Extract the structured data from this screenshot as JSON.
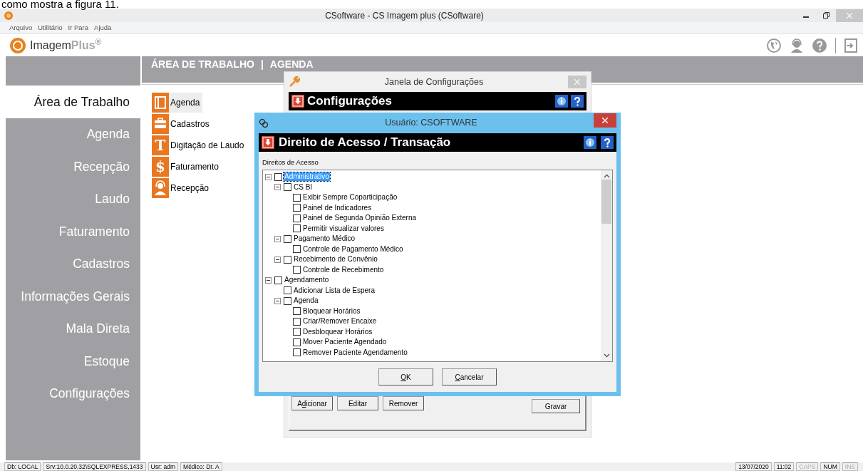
{
  "document_caption": "como mostra a figura 11.",
  "window": {
    "title": "CSoftware - CS Imagem plus (CSoftware)"
  },
  "menu": [
    "Arquivo",
    "Utilitário",
    "Ir Para",
    "Ajuda"
  ],
  "logo": {
    "name": "Imagem",
    "accent": "Plus$^{®}$"
  },
  "sidebar": {
    "items": [
      {
        "label": "Área de Trabalho",
        "selected": true
      },
      {
        "label": "Agenda",
        "selected": false
      },
      {
        "label": "Recepção",
        "selected": false
      },
      {
        "label": "Laudo",
        "selected": false
      },
      {
        "label": "Faturamento",
        "selected": false
      },
      {
        "label": "Cadastros",
        "selected": false
      },
      {
        "label": "Informações Gerais",
        "selected": false
      },
      {
        "label": "Mala Direta",
        "selected": false
      },
      {
        "label": "Estoque",
        "selected": false
      },
      {
        "label": "Configurações",
        "selected": false
      }
    ]
  },
  "breadcrumb": [
    "ÁREA DE TRABALHO",
    "|",
    "AGENDA"
  ],
  "tiles": [
    {
      "label": "Agenda",
      "kind": "book",
      "selected": true
    },
    {
      "label": "Cadastros",
      "kind": "case",
      "selected": false
    },
    {
      "label": "Digitação de Laudo",
      "kind": "glyph",
      "glyph": "T",
      "selected": false
    },
    {
      "label": "Faturamento",
      "kind": "glyph",
      "glyph": "$",
      "selected": false
    },
    {
      "label": "Recepção",
      "kind": "person",
      "selected": false
    }
  ],
  "config_window": {
    "title": "Janela de Configurações",
    "header": "Configurações",
    "buttons": [
      {
        "prefix": "A",
        "key": "d",
        "rest": "icionar"
      },
      {
        "rest": "Editar"
      },
      {
        "rest": "Remover"
      }
    ],
    "save_button": "Gravar"
  },
  "user_dialog": {
    "title": "Usuário: CSOFTWARE",
    "header": "Direito de Acesso / Transação",
    "tree_label": "Direitos de Acesso",
    "tree": [
      {
        "label": "Administrativo",
        "checked": false,
        "selected": true,
        "expanded": true,
        "children": [
          {
            "label": "CS BI",
            "checked": false,
            "selected": false,
            "expanded": true,
            "children": [
              {
                "label": "Exibir Sempre Coparticipação",
                "checked": false,
                "selected": false
              },
              {
                "label": "Painel de Indicadores",
                "checked": false,
                "selected": false
              },
              {
                "label": "Painel de Segunda Opinião Externa",
                "checked": false,
                "selected": false
              },
              {
                "label": "Permitir visualizar valores",
                "checked": false,
                "selected": false
              }
            ]
          },
          {
            "label": "Pagamento Médico",
            "checked": false,
            "selected": false,
            "expanded": true,
            "children": [
              {
                "label": "Controle de Pagamento Médico",
                "checked": false,
                "selected": false
              }
            ]
          },
          {
            "label": "Recebimento de Convênio",
            "checked": false,
            "selected": false,
            "expanded": true,
            "children": [
              {
                "label": "Controle de Recebimento",
                "checked": false,
                "selected": false
              }
            ]
          }
        ]
      },
      {
        "label": "Agendamento",
        "checked": false,
        "selected": false,
        "expanded": true,
        "children": [
          {
            "label": "Adicionar Lista de Espera",
            "checked": false,
            "selected": false
          },
          {
            "label": "Agenda",
            "checked": false,
            "selected": false,
            "expanded": true,
            "children": [
              {
                "label": "Bloquear Horários",
                "checked": false,
                "selected": false
              },
              {
                "label": "Criar/Remover Encaixe",
                "checked": false,
                "selected": false
              },
              {
                "label": "Desbloquear Horários",
                "checked": false,
                "selected": false
              },
              {
                "label": "Mover Paciente Agendado",
                "checked": false,
                "selected": false
              },
              {
                "label": "Remover Paciente Agendamento",
                "checked": false,
                "selected": false
              }
            ]
          }
        ]
      }
    ],
    "buttons": [
      {
        "key": "O",
        "rest": "K"
      },
      {
        "key": "C",
        "rest": "ancelar"
      }
    ]
  },
  "status_bar": {
    "left": [
      "Db: LOCAL",
      "Srv:10.0.20.32\\SQLEXPRESS,1433",
      "Usr: adm",
      "Médico: Dr. A"
    ],
    "right": [
      {
        "text": "13/07/2020",
        "enabled": true
      },
      {
        "text": "11:02",
        "enabled": true
      },
      {
        "text": "CAPS",
        "enabled": false
      },
      {
        "text": "NUM",
        "enabled": true
      },
      {
        "text": "INS",
        "enabled": false
      }
    ]
  }
}
